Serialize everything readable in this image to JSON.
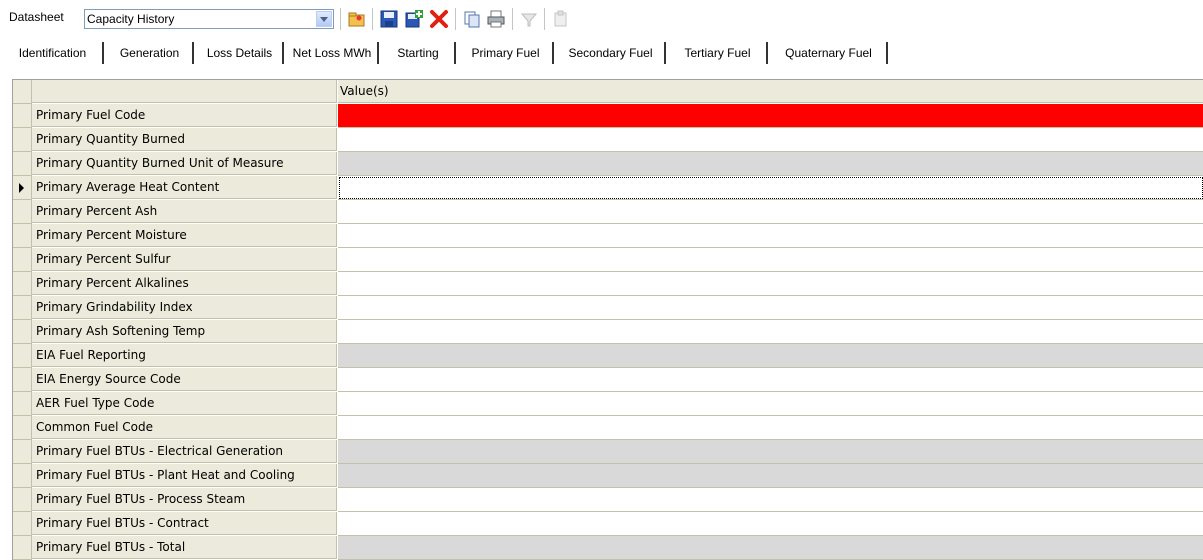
{
  "toolbar": {
    "datasheet_label": "Datasheet",
    "datasheet_value": "Capacity History",
    "buttons": [
      "open-folder-icon",
      "save-icon",
      "add-record-icon",
      "delete-icon",
      "copy-icon",
      "print-icon",
      "filter-icon",
      "paste-icon"
    ]
  },
  "tabs": [
    {
      "label": "Identification",
      "active": false
    },
    {
      "label": "Generation",
      "active": false
    },
    {
      "label": "Loss Details",
      "active": false
    },
    {
      "label": "Net Loss MWh",
      "active": false
    },
    {
      "label": "Starting",
      "active": false
    },
    {
      "label": "Primary Fuel",
      "active": true
    },
    {
      "label": "Secondary Fuel",
      "active": false
    },
    {
      "label": "Tertiary Fuel",
      "active": false
    },
    {
      "label": "Quaternary Fuel",
      "active": false
    }
  ],
  "grid": {
    "column_header": "Value(s)",
    "rows": [
      {
        "label": "Primary Fuel Code",
        "style": "red",
        "current": false
      },
      {
        "label": "Primary Quantity Burned",
        "style": "white",
        "current": false
      },
      {
        "label": "Primary Quantity Burned Unit of Measure",
        "style": "gray",
        "current": false
      },
      {
        "label": "Primary Average Heat Content",
        "style": "white",
        "current": true
      },
      {
        "label": "Primary Percent Ash",
        "style": "white",
        "current": false
      },
      {
        "label": "Primary Percent Moisture",
        "style": "white",
        "current": false
      },
      {
        "label": "Primary Percent Sulfur",
        "style": "white",
        "current": false
      },
      {
        "label": "Primary Percent Alkalines",
        "style": "white",
        "current": false
      },
      {
        "label": "Primary Grindability Index",
        "style": "white",
        "current": false
      },
      {
        "label": "Primary Ash Softening Temp",
        "style": "white",
        "current": false
      },
      {
        "label": "EIA Fuel Reporting",
        "style": "gray",
        "current": false
      },
      {
        "label": "EIA Energy Source Code",
        "style": "white",
        "current": false
      },
      {
        "label": "AER Fuel Type Code",
        "style": "white",
        "current": false
      },
      {
        "label": "Common Fuel Code",
        "style": "white",
        "current": false
      },
      {
        "label": "Primary Fuel BTUs - Electrical Generation",
        "style": "gray",
        "current": false
      },
      {
        "label": "Primary Fuel BTUs - Plant Heat and Cooling",
        "style": "gray",
        "current": false
      },
      {
        "label": "Primary Fuel BTUs - Process Steam",
        "style": "white",
        "current": false
      },
      {
        "label": "Primary Fuel BTUs - Contract",
        "style": "white",
        "current": false
      },
      {
        "label": "Primary Fuel BTUs - Total",
        "style": "gray",
        "current": false
      }
    ]
  },
  "colors": {
    "required_cell": "#ff0000",
    "readonly_cell": "#d9d9d9",
    "row_header": "#ebeadb"
  }
}
